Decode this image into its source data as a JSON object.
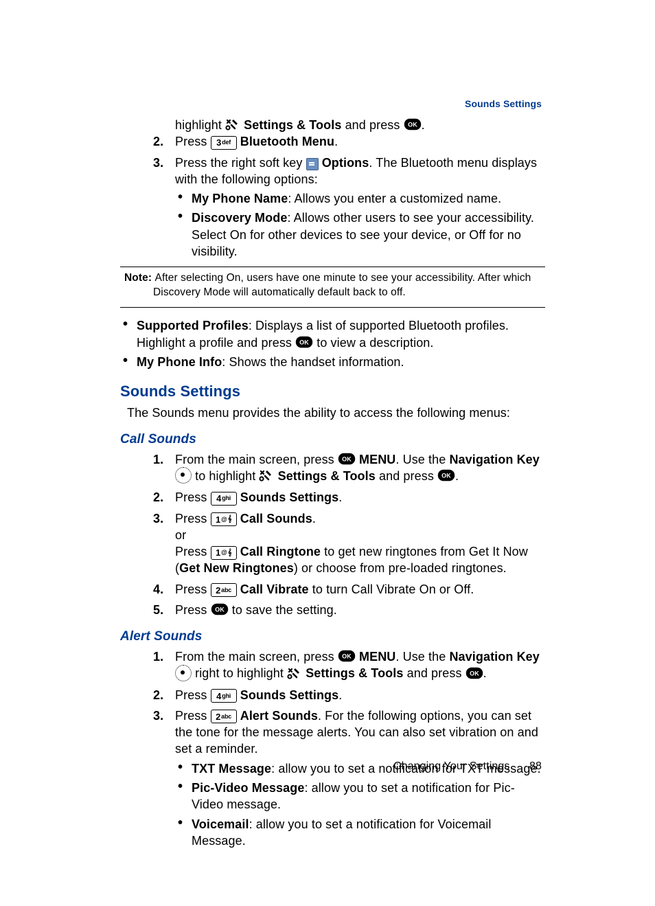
{
  "header": {
    "section_label": "Sounds Settings"
  },
  "intro": {
    "line1_a": "highlight ",
    "line1_b": "Settings & Tools",
    "line1_c": " and press ",
    "line1_d": "."
  },
  "bt_steps": {
    "s2_a": "Press ",
    "s2_key_digit": "3",
    "s2_key_label": "def",
    "s2_b": " ",
    "s2_c": "Bluetooth Menu",
    "s2_d": ".",
    "s3_a": "Press the right soft key ",
    "s3_b": " ",
    "s3_c": "Options",
    "s3_d": ". The Bluetooth menu displays with the following options:",
    "bul1_a": "My Phone Name",
    "bul1_b": ": Allows you enter a customized name.",
    "bul2_a": "Discovery Mode",
    "bul2_b": ": Allows other users to see your accessibility. Select On for other devices to see your device, or Off for no visibility."
  },
  "note": {
    "label": "Note: ",
    "text": "After selecting On, users have one minute to see your accessibility. After which Discovery Mode will automatically default back to off."
  },
  "bt_more": {
    "bul3_a": "Supported Profiles",
    "bul3_b": ": Displays a list of supported Bluetooth profiles. Highlight a profile and press ",
    "bul3_c": " to view a description.",
    "bul4_a": "My Phone Info",
    "bul4_b": ": Shows the handset information."
  },
  "sounds": {
    "heading": "Sounds Settings",
    "intro": "The Sounds menu provides the ability to access the following menus:"
  },
  "call_sounds": {
    "heading": "Call Sounds",
    "s1_a": "From the main screen, press ",
    "s1_b": " ",
    "s1_c": "MENU",
    "s1_d": ". Use the ",
    "s1_e": "Navigation Key",
    "s1_f": " ",
    "s1_g": " to highlight ",
    "s1_h": "Settings & Tools",
    "s1_i": " and press ",
    "s1_j": ".",
    "s2_a": "Press ",
    "s2_key_digit": "4",
    "s2_key_label": "ghi",
    "s2_b": " ",
    "s2_c": "Sounds Settings",
    "s2_d": ".",
    "s3_a": "Press ",
    "s3_key_digit": "1",
    "s3_key_label": "@",
    "s3_key_ico": "𝄞",
    "s3_b": " ",
    "s3_c": "Call Sounds",
    "s3_d": ".",
    "s3_or": "or",
    "s3e_a": "Press ",
    "s3e_b": " ",
    "s3e_c": "Call Ringtone",
    "s3e_d": " to get new ringtones from Get It Now (",
    "s3e_e": "Get New Ringtones",
    "s3e_f": ") or choose from pre-loaded ringtones.",
    "s4_a": "Press ",
    "s4_key_digit": "2",
    "s4_key_label": "abc",
    "s4_b": " ",
    "s4_c": "Call Vibrate",
    "s4_d": " to turn Call Vibrate On or Off.",
    "s5_a": "Press ",
    "s5_b": " to save the setting."
  },
  "alert_sounds": {
    "heading": "Alert Sounds",
    "s1_a": "From the main screen, press ",
    "s1_b": " ",
    "s1_c": "MENU",
    "s1_d": ". Use the ",
    "s1_e": "Navigation Key",
    "s1_f": " ",
    "s1_g": " right to highlight ",
    "s1_h": "Settings & Tools",
    "s1_i": " and press ",
    "s1_j": ".",
    "s2_a": "Press ",
    "s2_key_digit": "4",
    "s2_key_label": "ghi",
    "s2_b": " ",
    "s2_c": "Sounds Settings",
    "s2_d": ".",
    "s3_a": "Press ",
    "s3_key_digit": "2",
    "s3_key_label": "abc",
    "s3_b": " ",
    "s3_c": "Alert Sounds",
    "s3_d": ". For the following options, you can set the tone for the message alerts. You can also set vibration on and set a reminder.",
    "bul1_a": "TXT Message",
    "bul1_b": ": allow you to set a notification for TXT message.",
    "bul2_a": "Pic-Video Message",
    "bul2_b": ": allow you to set a notification for Pic-Video message.",
    "bul3_a": "Voicemail",
    "bul3_b": ": allow you to set a notification for Voicemail Message."
  },
  "footer": {
    "chapter": "Changing Your Settings",
    "page": "88"
  }
}
